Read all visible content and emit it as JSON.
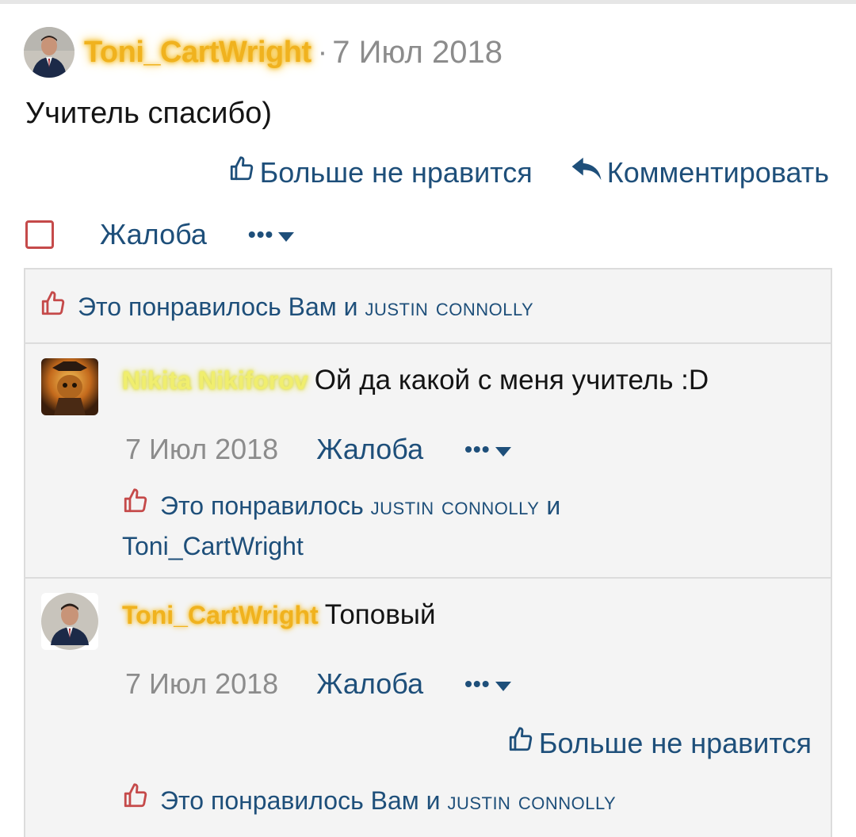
{
  "post": {
    "author": "Toni_CartWright",
    "separator": "·",
    "date": "7 Июл 2018",
    "body": "Учитель спасибо)",
    "unlike_label": "Больше не нравится",
    "comment_label": "Комментировать",
    "report_label": "Жалоба",
    "more_label": "•••",
    "likes_prefix": "Это понравилось Вам и",
    "likes_user": "Justin Connolly"
  },
  "comments": [
    {
      "author": "Nikita Nikiforov",
      "text": "Ой да какой с меня учитель :D",
      "date": "7 Июл 2018",
      "report_label": "Жалоба",
      "more_label": "•••",
      "likes_prefix": "Это понравилось",
      "likes_user": "Justin Connolly",
      "likes_and": "и",
      "likes_user2": "Toni_CartWright"
    },
    {
      "author": "Toni_CartWright",
      "text": "Топовый",
      "date": "7 Июл 2018",
      "report_label": "Жалоба",
      "more_label": "•••",
      "unlike_label": "Больше не нравится",
      "likes_prefix": "Это понравилось Вам и",
      "likes_user": "Justin Connolly"
    }
  ],
  "colors": {
    "link": "#1e4f7a",
    "muted": "#8c8c8c",
    "gold_name": "#f0b21e",
    "green_name": "#f0ee6e",
    "like_icon": "#c54a4a",
    "panel_bg": "#f4f4f4"
  },
  "icons": {
    "like": "thumbs-up-outline-icon",
    "reply": "reply-arrow-icon",
    "caret": "caret-down-icon",
    "liked": "thumbs-up-red-icon"
  }
}
